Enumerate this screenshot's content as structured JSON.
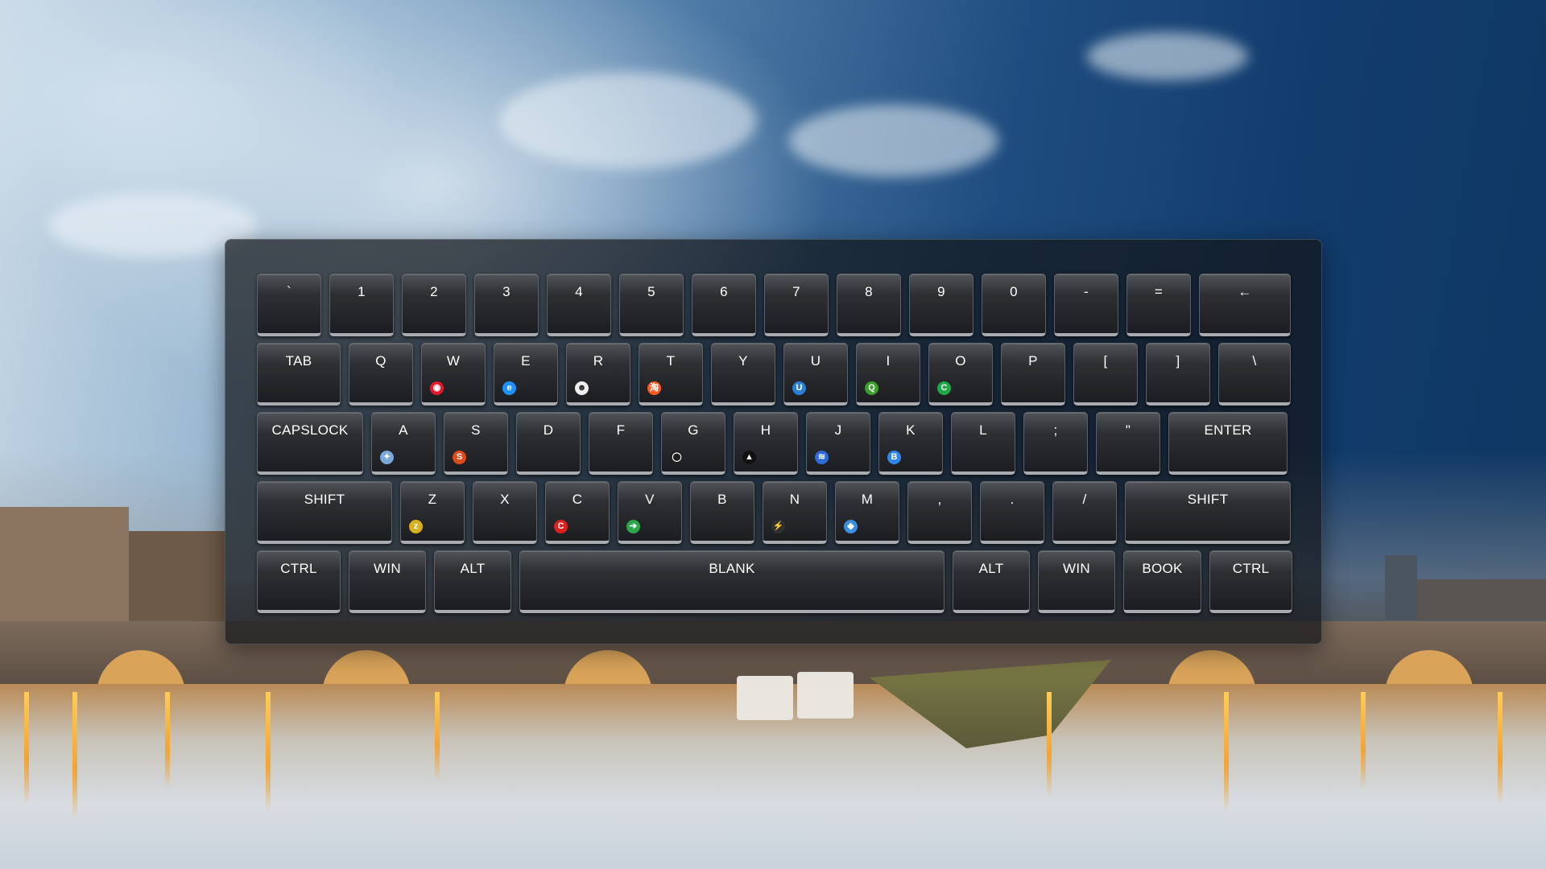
{
  "keyboard": {
    "row1": [
      "`",
      "1",
      "2",
      "3",
      "4",
      "5",
      "6",
      "7",
      "8",
      "9",
      "0",
      "-",
      "=",
      "←"
    ],
    "row2": [
      "TAB",
      "Q",
      "W",
      "E",
      "R",
      "T",
      "Y",
      "U",
      "I",
      "O",
      "P",
      "[",
      "]",
      "\\"
    ],
    "row3": [
      "CAPSLOCK",
      "A",
      "S",
      "D",
      "F",
      "G",
      "H",
      "J",
      "K",
      "L",
      ";",
      "\"",
      "ENTER"
    ],
    "row4": [
      "SHIFT",
      "Z",
      "X",
      "C",
      "V",
      "B",
      "N",
      "M",
      ",",
      ".",
      "/",
      "SHIFT"
    ],
    "row5": [
      "CTRL",
      "WIN",
      "ALT",
      "BLANK",
      "ALT",
      "WIN",
      "BOOK",
      "CTRL"
    ]
  },
  "icons": {
    "W": {
      "name": "weibo-icon",
      "glyph": "◉",
      "color": "#e6162d"
    },
    "E": {
      "name": "ie-browser-icon",
      "glyph": "e",
      "color": "#1e90ff"
    },
    "R": {
      "name": "rabbit-icon",
      "glyph": "☻",
      "color": "#eeeeee"
    },
    "T": {
      "name": "taobao-icon",
      "glyph": "淘",
      "color": "#ff5a1f"
    },
    "U": {
      "name": "ui-icon",
      "glyph": "U",
      "color": "#2a7fd4"
    },
    "I": {
      "name": "iqiyi-icon",
      "glyph": "Q",
      "color": "#3aa02a"
    },
    "O": {
      "name": "c-logo-icon",
      "glyph": "C",
      "color": "#1fa84a"
    },
    "A": {
      "name": "bird-icon",
      "glyph": "✦",
      "color": "#7aa9d8"
    },
    "S": {
      "name": "s-logo-icon",
      "glyph": "S",
      "color": "#e04a1a"
    },
    "G": {
      "name": "github-icon",
      "glyph": "◯",
      "color": "#202020"
    },
    "H": {
      "name": "triangle-icon",
      "glyph": "▲",
      "color": "#111111"
    },
    "J": {
      "name": "layers-icon",
      "glyph": "≋",
      "color": "#2f6bd8"
    },
    "K": {
      "name": "b-logo-icon",
      "glyph": "B",
      "color": "#2f86e8"
    },
    "Z": {
      "name": "z-logo-icon",
      "glyph": "z",
      "color": "#d8b020"
    },
    "C": {
      "name": "csdn-icon",
      "glyph": "C",
      "color": "#e02020"
    },
    "V": {
      "name": "v-logo-icon",
      "glyph": "➔",
      "color": "#2aa84a"
    },
    "N": {
      "name": "bolt-icon",
      "glyph": "⚡",
      "color": "#303030"
    },
    "M": {
      "name": "bird-blue-icon",
      "glyph": "◆",
      "color": "#3a8fe0"
    }
  }
}
